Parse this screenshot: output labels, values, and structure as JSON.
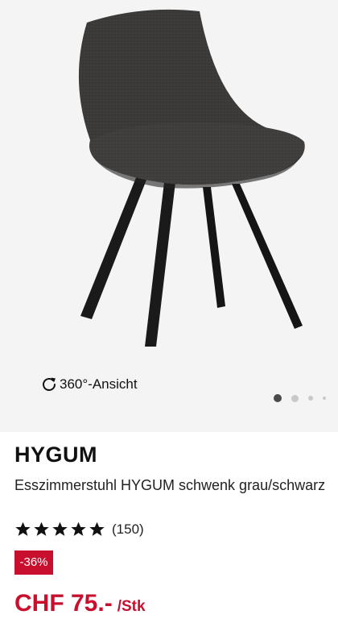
{
  "gallery": {
    "view_360_label": "360°-Ansicht",
    "slide_count": 4,
    "active_slide": 1
  },
  "product": {
    "brand": "HYGUM",
    "title": "Esszimmerstuhl HYGUM schwenk grau/schwarz",
    "rating": 5,
    "rating_max": 5,
    "review_count": "(150)",
    "discount_badge": "-36%",
    "price": "CHF 75.-",
    "price_unit": "/Stk"
  },
  "colors": {
    "accent_red": "#c8102e",
    "gallery_bg": "#f4f4f4",
    "upholstery": "#3e3d3b",
    "legs": "#151515"
  },
  "icons": {
    "rotate": "rotate-360-icon",
    "star": "star-icon"
  }
}
